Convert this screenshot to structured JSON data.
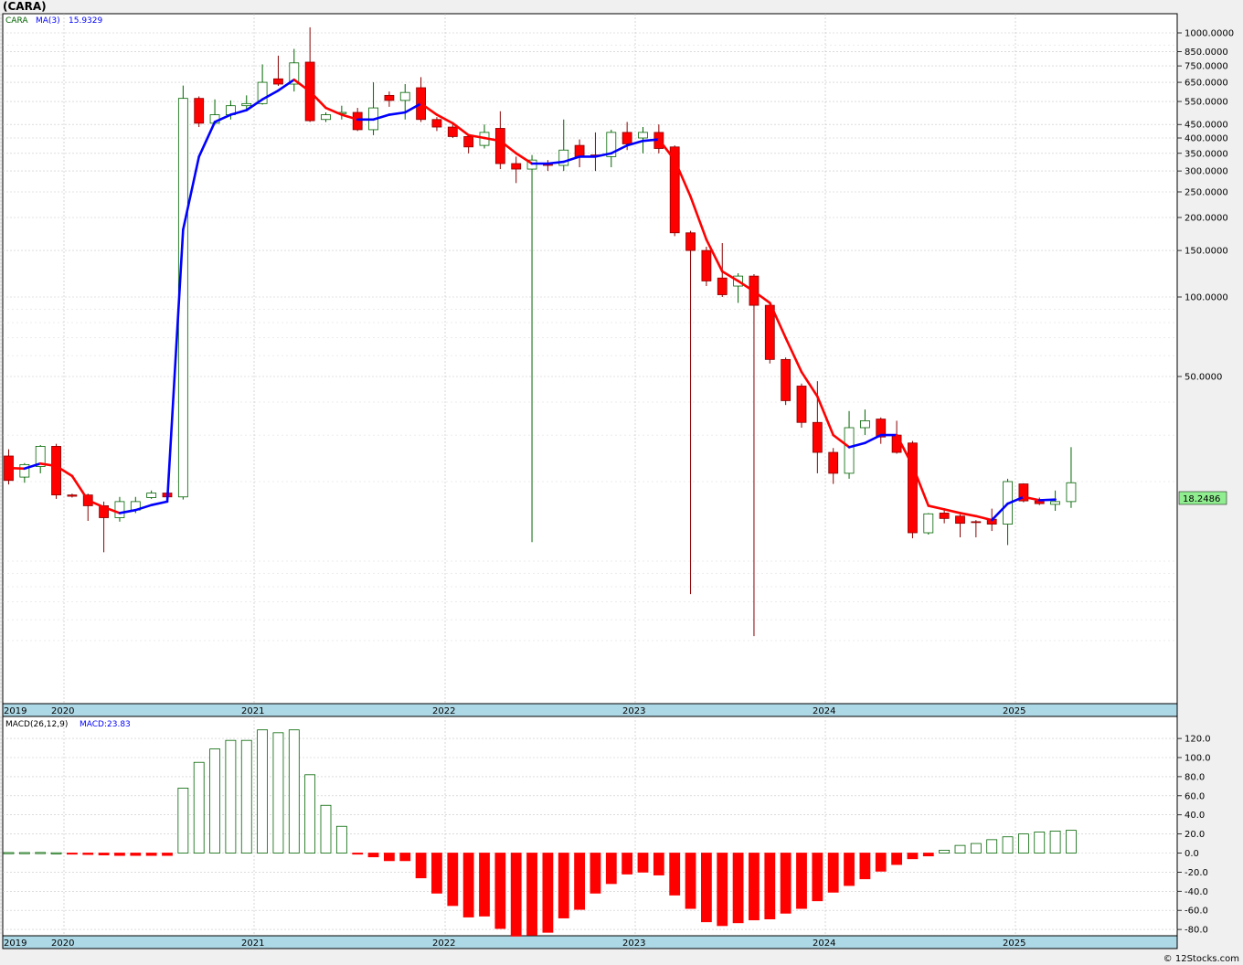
{
  "window": {
    "title": "(CARA)",
    "watermark": "© 12Stocks.com"
  },
  "colors": {
    "up": "#006400",
    "down": "#ff0000",
    "ma_up": "#0000ff",
    "ma_down": "#ff0000",
    "axis_band": "#add8e6",
    "price_tag": "#90ee90"
  },
  "chart_data": [
    {
      "type": "candlestick",
      "name": "price",
      "scale": "log",
      "legend": {
        "symbol": "CARA",
        "ma_label": "MA(3)",
        "ma_value": "15.9329"
      },
      "last_price_label": "18.2486",
      "y_ticks": [
        "1000.0000",
        "850.0000",
        "750.0000",
        "650.0000",
        "550.0000",
        "450.0000",
        "400.0000",
        "350.0000",
        "300.0000",
        "250.0000",
        "200.0000",
        "150.0000",
        "100.0000",
        "50.0000"
      ],
      "years": [
        "2019",
        "2020",
        "2021",
        "2022",
        "2023",
        "2024",
        "2025"
      ],
      "grid": true,
      "candles": [
        {
          "o": 25,
          "h": 26.5,
          "l": 19.5,
          "c": 20.2
        },
        {
          "o": 20.8,
          "h": 23.5,
          "l": 19.8,
          "c": 23.2
        },
        {
          "o": 22.8,
          "h": 27.5,
          "l": 21.5,
          "c": 27.2
        },
        {
          "o": 27.2,
          "h": 27.8,
          "l": 17.2,
          "c": 17.8
        },
        {
          "o": 17.8,
          "h": 18,
          "l": 17.4,
          "c": 17.6
        },
        {
          "o": 17.8,
          "h": 18,
          "l": 14.2,
          "c": 16.2
        },
        {
          "o": 16.2,
          "h": 16.8,
          "l": 10.8,
          "c": 14.6
        },
        {
          "o": 14.6,
          "h": 17.5,
          "l": 14.1,
          "c": 16.8
        },
        {
          "o": 15.6,
          "h": 17.5,
          "l": 15.2,
          "c": 16.8
        },
        {
          "o": 17.4,
          "h": 18.5,
          "l": 17.2,
          "c": 18.1
        },
        {
          "o": 18.1,
          "h": 18.4,
          "l": 17.3,
          "c": 17.5
        },
        {
          "o": 17.5,
          "h": 632,
          "l": 17.1,
          "c": 565
        },
        {
          "o": 565,
          "h": 575,
          "l": 440,
          "c": 455
        },
        {
          "o": 455,
          "h": 560,
          "l": 450,
          "c": 490
        },
        {
          "o": 490,
          "h": 555,
          "l": 470,
          "c": 530
        },
        {
          "o": 530,
          "h": 580,
          "l": 510,
          "c": 540
        },
        {
          "o": 540,
          "h": 760,
          "l": 535,
          "c": 650
        },
        {
          "o": 670,
          "h": 820,
          "l": 630,
          "c": 640
        },
        {
          "o": 640,
          "h": 870,
          "l": 600,
          "c": 770
        },
        {
          "o": 775,
          "h": 1050,
          "l": 460,
          "c": 465
        },
        {
          "o": 470,
          "h": 500,
          "l": 460,
          "c": 490
        },
        {
          "o": 495,
          "h": 530,
          "l": 470,
          "c": 500
        },
        {
          "o": 500,
          "h": 520,
          "l": 425,
          "c": 430
        },
        {
          "o": 430,
          "h": 650,
          "l": 410,
          "c": 520
        },
        {
          "o": 580,
          "h": 600,
          "l": 525,
          "c": 555
        },
        {
          "o": 555,
          "h": 640,
          "l": 470,
          "c": 595
        },
        {
          "o": 620,
          "h": 680,
          "l": 460,
          "c": 470
        },
        {
          "o": 470,
          "h": 480,
          "l": 425,
          "c": 440
        },
        {
          "o": 440,
          "h": 455,
          "l": 400,
          "c": 405
        },
        {
          "o": 405,
          "h": 410,
          "l": 350,
          "c": 370
        },
        {
          "o": 375,
          "h": 450,
          "l": 365,
          "c": 420
        },
        {
          "o": 435,
          "h": 505,
          "l": 305,
          "c": 320
        },
        {
          "o": 320,
          "h": 340,
          "l": 270,
          "c": 305
        },
        {
          "o": 305,
          "h": 345,
          "l": 11.8,
          "c": 330
        },
        {
          "o": 320,
          "h": 330,
          "l": 300,
          "c": 315
        },
        {
          "o": 315,
          "h": 470,
          "l": 300,
          "c": 360
        },
        {
          "o": 375,
          "h": 395,
          "l": 310,
          "c": 340
        },
        {
          "o": 345,
          "h": 420,
          "l": 300,
          "c": 342
        },
        {
          "o": 340,
          "h": 430,
          "l": 310,
          "c": 420
        },
        {
          "o": 420,
          "h": 460,
          "l": 360,
          "c": 380
        },
        {
          "o": 400,
          "h": 440,
          "l": 350,
          "c": 420
        },
        {
          "o": 420,
          "h": 450,
          "l": 350,
          "c": 365
        },
        {
          "o": 370,
          "h": 375,
          "l": 170,
          "c": 175
        },
        {
          "o": 175,
          "h": 178,
          "l": 7.5,
          "c": 150
        },
        {
          "o": 150,
          "h": 155,
          "l": 110,
          "c": 115
        },
        {
          "o": 118,
          "h": 160,
          "l": 100,
          "c": 102
        },
        {
          "o": 110,
          "h": 123,
          "l": 95,
          "c": 120
        },
        {
          "o": 120,
          "h": 122,
          "l": 5.2,
          "c": 93
        },
        {
          "o": 93,
          "h": 95,
          "l": 56,
          "c": 58
        },
        {
          "o": 58,
          "h": 59,
          "l": 39,
          "c": 40.5
        },
        {
          "o": 46,
          "h": 47,
          "l": 32,
          "c": 33.5
        },
        {
          "o": 33.5,
          "h": 48,
          "l": 21.5,
          "c": 25.8
        },
        {
          "o": 25.8,
          "h": 26.8,
          "l": 19.6,
          "c": 21.5
        },
        {
          "o": 21.5,
          "h": 37,
          "l": 20.5,
          "c": 32
        },
        {
          "o": 32,
          "h": 37.5,
          "l": 30,
          "c": 34
        },
        {
          "o": 34.5,
          "h": 35,
          "l": 27.8,
          "c": 29.5
        },
        {
          "o": 30,
          "h": 34,
          "l": 25.5,
          "c": 25.8
        },
        {
          "o": 28,
          "h": 28.5,
          "l": 12.2,
          "c": 12.8
        },
        {
          "o": 12.8,
          "h": 15.2,
          "l": 12.6,
          "c": 15.1
        },
        {
          "o": 15.2,
          "h": 15.6,
          "l": 13.9,
          "c": 14.5
        },
        {
          "o": 14.8,
          "h": 15,
          "l": 12.3,
          "c": 13.9
        },
        {
          "o": 14.1,
          "h": 14.3,
          "l": 12.3,
          "c": 14
        },
        {
          "o": 14.4,
          "h": 15.8,
          "l": 13,
          "c": 13.8
        },
        {
          "o": 13.8,
          "h": 20.5,
          "l": 11.5,
          "c": 20
        },
        {
          "o": 19.6,
          "h": 19.7,
          "l": 16.7,
          "c": 16.9
        },
        {
          "o": 16.9,
          "h": 17.4,
          "l": 16.3,
          "c": 16.5
        },
        {
          "o": 16.4,
          "h": 18.5,
          "l": 15.5,
          "c": 16.8
        },
        {
          "o": 16.8,
          "h": 27,
          "l": 15.9,
          "c": 19.8
        }
      ],
      "ma": [
        22.5,
        22.4,
        23.4,
        22.9,
        21,
        17,
        16,
        15.2,
        15.6,
        16.3,
        16.8,
        180,
        340,
        460,
        490,
        510,
        560,
        605,
        665,
        600,
        520,
        490,
        470,
        470,
        490,
        500,
        540,
        490,
        455,
        410,
        400,
        390,
        350,
        320,
        320,
        325,
        340,
        340,
        350,
        375,
        390,
        395,
        330,
        240,
        165,
        125,
        115,
        105,
        95,
        70,
        52,
        42,
        30,
        27,
        28,
        30,
        30,
        23,
        16.2,
        15.7,
        15.2,
        14.8,
        14.3,
        16.5,
        17.5,
        17,
        17.1
      ]
    },
    {
      "type": "bar",
      "name": "histogram",
      "legend": {
        "label": "MACD(26,12,9)",
        "value_label": "MACD:23.83"
      },
      "y_ticks": [
        "120.0",
        "100.0",
        "80.0",
        "60.0",
        "40.0",
        "20.0",
        "0.0",
        "-20.0",
        "-40.0",
        "-60.0",
        "-80.0"
      ],
      "ylim": [
        -88,
        133
      ],
      "values": [
        0.5,
        0.5,
        0.6,
        0.3,
        -1,
        -1.5,
        -2,
        -2.5,
        -2.5,
        -2.5,
        -2.5,
        68,
        95,
        109,
        118,
        118,
        129,
        126,
        129,
        82,
        50,
        28,
        -1,
        -4,
        -8,
        -8,
        -26,
        -42,
        -55,
        -67,
        -66,
        -79,
        -87,
        -86,
        -83,
        -68,
        -59,
        -42,
        -32,
        -22,
        -20,
        -23,
        -44,
        -58,
        -72,
        -76,
        -73,
        -70,
        -69,
        -63,
        -58,
        -50,
        -41,
        -34,
        -27,
        -19,
        -12,
        -6,
        -3,
        3,
        8,
        10,
        14,
        17,
        20,
        22,
        23,
        23.8
      ]
    }
  ]
}
